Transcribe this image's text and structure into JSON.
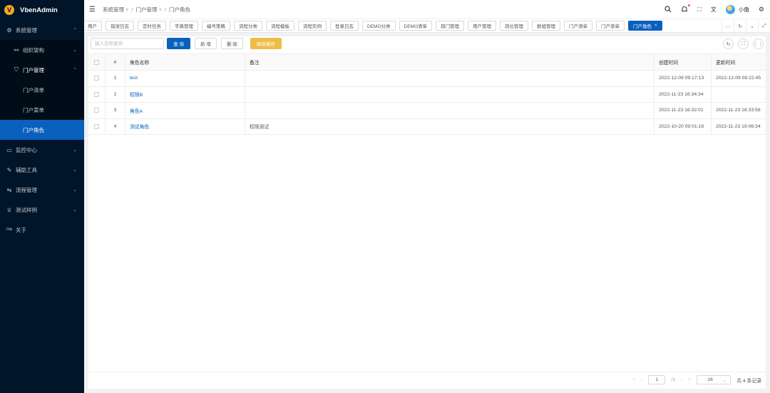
{
  "app": {
    "logo_letter": "V",
    "title": "VbenAdmin"
  },
  "sidebar": {
    "items": [
      {
        "label": "系统管理",
        "icon": "gear-icon",
        "glyph": "⚙",
        "chev": "⌃"
      },
      {
        "label": "组织架构",
        "icon": "org-icon",
        "glyph": "⚯",
        "chev": "⌄"
      },
      {
        "label": "门户管理",
        "icon": "shield-icon",
        "glyph": "⛉",
        "chev": "⌃"
      },
      {
        "label": "门户清单"
      },
      {
        "label": "门户菜单"
      },
      {
        "label": "门户角色"
      },
      {
        "label": "监控中心",
        "icon": "monitor-icon",
        "glyph": "▭",
        "chev": "⌄"
      },
      {
        "label": "辅助工具",
        "icon": "tool-icon",
        "glyph": "✎",
        "chev": "⌄"
      },
      {
        "label": "流程管理",
        "icon": "flow-icon",
        "glyph": "⇆",
        "chev": "⌄"
      },
      {
        "label": "测试样例",
        "icon": "trophy-icon",
        "glyph": "♕",
        "chev": "⌄"
      },
      {
        "label": "关于",
        "icon": "about-icon",
        "glyph": "me"
      }
    ]
  },
  "header": {
    "breadcrumb": [
      "系统管理",
      "门户管理",
      "门户角色"
    ],
    "caret": "∨",
    "username": "小傲"
  },
  "tabs": [
    "用户",
    "错误日志",
    "定时任务",
    "字典管理",
    "编号策略",
    "流程分类",
    "流程模板",
    "流程实例",
    "登录日志",
    "DEMO分类",
    "DEMO清单",
    "部门管理",
    "用户管理",
    "岗位管理",
    "群组管理",
    "门户清单",
    "门户菜单",
    "门户角色"
  ],
  "tab_close": "×",
  "toolbar": {
    "search_placeholder": "输入名称查询",
    "query": "查 询",
    "add": "新 增",
    "delete": "删 除",
    "refresh_cache": "刷新缓存"
  },
  "table": {
    "headers": {
      "index": "#",
      "name": "角色名称",
      "remark": "备注",
      "created": "创建时间",
      "updated": "更新时间"
    },
    "rows": [
      {
        "index": "1",
        "name": "test",
        "remark": "",
        "created": "2022-12-09 09:17:13",
        "updated": "2022-12-09 09:22:45"
      },
      {
        "index": "2",
        "name": "权限B",
        "remark": "",
        "created": "2022-11-23 16:34:34",
        "updated": ""
      },
      {
        "index": "3",
        "name": "角色A",
        "remark": "",
        "created": "2022-11-23 16:32:01",
        "updated": "2022-11-23 16:33:58"
      },
      {
        "index": "4",
        "name": "测试角色",
        "remark": "权限测试",
        "created": "2022-10-20 09:01:18",
        "updated": "2022-11-23 19:06:34"
      }
    ]
  },
  "pager": {
    "current": "1",
    "of": "/1",
    "page_size": "16",
    "total": "共 4 条记录"
  },
  "colors": {
    "primary": "#0960bd",
    "sidebar_bg": "#001529",
    "warn": "#efbd47"
  }
}
